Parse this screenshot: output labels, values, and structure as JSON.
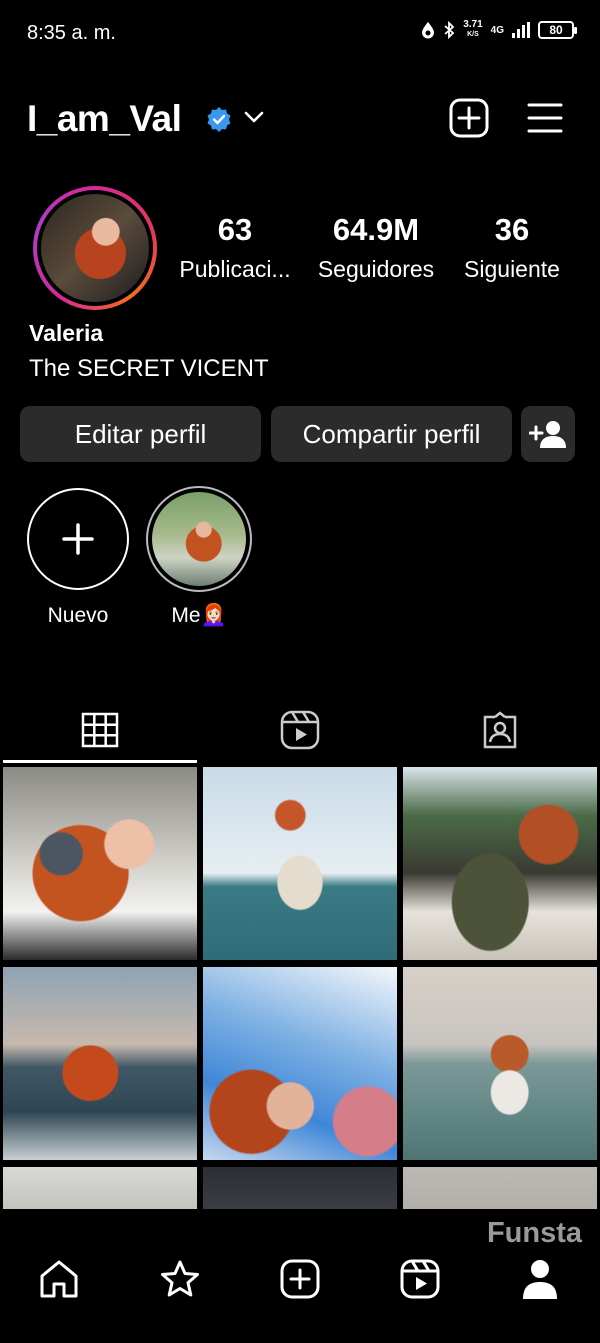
{
  "status_bar": {
    "time": "8:35 a. m.",
    "net_speed_value": "3.71",
    "net_speed_unit": "K/S",
    "network": "4G",
    "battery": "80"
  },
  "header": {
    "username": "I_am_Val"
  },
  "profile": {
    "stats": [
      {
        "value": "63",
        "label": "Publicaci..."
      },
      {
        "value": "64.9M",
        "label": "Seguidores"
      },
      {
        "value": "36",
        "label": "Siguiente"
      }
    ],
    "name": "Valeria",
    "bio": "The SECRET VICENT"
  },
  "actions": {
    "edit": "Editar perfil",
    "share": "Compartir perfil"
  },
  "highlights": {
    "new_label": "Nuevo",
    "me_label": "Me👩🏻‍🦰"
  },
  "watermark": "Funsta",
  "colors": {
    "background": "#000000",
    "button": "#2b2b2b",
    "verified": "#3897f0"
  }
}
